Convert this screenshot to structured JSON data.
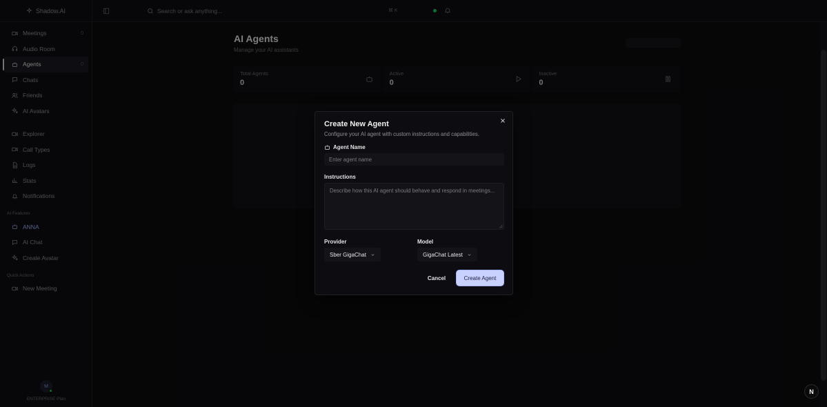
{
  "brand": {
    "name": "Shadow.AI"
  },
  "sidebar": {
    "main_items": [
      {
        "label": "Meetings",
        "count": "0",
        "icon": "video-icon"
      },
      {
        "label": "Audio Room",
        "count": "",
        "icon": "headphones-icon"
      },
      {
        "label": "Agents",
        "count": "0",
        "icon": "bot-icon",
        "active": true
      },
      {
        "label": "Chats",
        "count": "",
        "icon": "message-icon"
      },
      {
        "label": "Friends",
        "count": "",
        "icon": "users-icon"
      },
      {
        "label": "AI Avatars",
        "count": "",
        "icon": "sparkles-icon"
      }
    ],
    "secondary_items": [
      {
        "label": "Explorer",
        "icon": "video-icon"
      },
      {
        "label": "Call Types",
        "icon": "video-icon"
      },
      {
        "label": "Logs",
        "icon": "file-icon"
      },
      {
        "label": "Stats",
        "icon": "chart-icon"
      },
      {
        "label": "Notifications",
        "icon": "bell-icon"
      }
    ],
    "ai_features_label": "AI Features",
    "ai_features": [
      {
        "label": "ANNA",
        "icon": "bot-icon",
        "highlight": true
      },
      {
        "label": "AI Chat",
        "icon": "message-icon"
      },
      {
        "label": "Create Avatar",
        "icon": "sparkles-icon"
      }
    ],
    "quick_actions_label": "Quick Actions",
    "quick_actions": [
      {
        "label": "New Meeting",
        "icon": "video-icon"
      }
    ],
    "user": {
      "initial": "M",
      "plan": "ENTERPRISE Plan"
    }
  },
  "topbar": {
    "search_placeholder": "Search or ask anything...",
    "shortcut": "⌘ K"
  },
  "page": {
    "title": "AI Agents",
    "subtitle": "Manage your AI assistants",
    "stats": [
      {
        "label": "Total Agents",
        "value": "0",
        "icon": "bot-icon"
      },
      {
        "label": "Active",
        "value": "0",
        "icon": "play-icon"
      },
      {
        "label": "Inactive",
        "value": "0",
        "icon": "pause-icon"
      }
    ]
  },
  "modal": {
    "title": "Create New Agent",
    "description": "Configure your AI agent with custom instructions and capabilities.",
    "name_label": "Agent Name",
    "name_placeholder": "Enter agent name",
    "instructions_label": "Instructions",
    "instructions_placeholder": "Describe how this AI agent should behave and respond in meetings...",
    "provider_label": "Provider",
    "provider_value": "Sber GigaChat",
    "model_label": "Model",
    "model_value": "GigaChat Latest",
    "cancel_label": "Cancel",
    "create_label": "Create Agent"
  },
  "badge": {
    "letter": "N"
  },
  "colors": {
    "accent": "#c9d1ff",
    "online": "#22c55e",
    "background": "#0b0b0e"
  }
}
